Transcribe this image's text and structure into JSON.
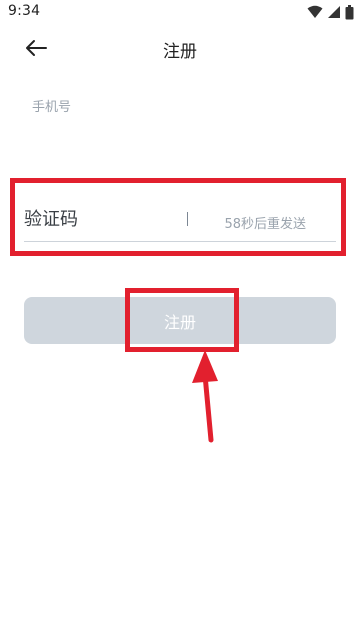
{
  "status_bar": {
    "time": "9:34",
    "icons": [
      "wifi-icon",
      "cellular-icon",
      "battery-icon"
    ]
  },
  "header": {
    "title": "注册",
    "back_icon": "arrow-left-icon"
  },
  "form": {
    "phone_label": "手机号",
    "code_placeholder": "验证码",
    "resend_text": "58秒后重发送"
  },
  "actions": {
    "register_label": "注册"
  },
  "colors": {
    "highlight": "#e2202e",
    "button_disabled": "#cfd6dd",
    "muted_text": "#9aa3ad"
  }
}
